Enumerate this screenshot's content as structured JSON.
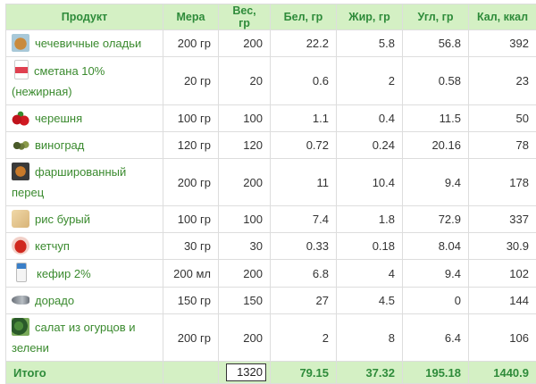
{
  "table": {
    "headers": [
      "Продукт",
      "Мера",
      "Вес, гр",
      "Бел, гр",
      "Жир, гр",
      "Угл, гр",
      "Кал, ккал"
    ],
    "rows": [
      {
        "name": "чечевичные оладьи",
        "icon": "pancakes-icon",
        "measure": "200 гр",
        "weight": "200",
        "protein": "22.2",
        "fat": "5.8",
        "carbs": "56.8",
        "kcal": "392"
      },
      {
        "name": "сметана 10% (нежирная)",
        "icon": "sour-cream-icon",
        "measure": "20 гр",
        "weight": "20",
        "protein": "0.6",
        "fat": "2",
        "carbs": "0.58",
        "kcal": "23"
      },
      {
        "name": "черешня",
        "icon": "cherry-icon",
        "measure": "100 гр",
        "weight": "100",
        "protein": "1.1",
        "fat": "0.4",
        "carbs": "11.5",
        "kcal": "50"
      },
      {
        "name": "виноград",
        "icon": "grapes-icon",
        "measure": "120 гр",
        "weight": "120",
        "protein": "0.72",
        "fat": "0.24",
        "carbs": "20.16",
        "kcal": "78"
      },
      {
        "name": "фаршированный перец",
        "icon": "stuffed-pepper-icon",
        "measure": "200 гр",
        "weight": "200",
        "protein": "11",
        "fat": "10.4",
        "carbs": "9.4",
        "kcal": "178"
      },
      {
        "name": "рис бурый",
        "icon": "rice-icon",
        "measure": "100 гр",
        "weight": "100",
        "protein": "7.4",
        "fat": "1.8",
        "carbs": "72.9",
        "kcal": "337"
      },
      {
        "name": "кетчуп",
        "icon": "ketchup-icon",
        "measure": "30 гр",
        "weight": "30",
        "protein": "0.33",
        "fat": "0.18",
        "carbs": "8.04",
        "kcal": "30.9"
      },
      {
        "name": "кефир 2%",
        "icon": "kefir-icon",
        "measure": "200 мл",
        "weight": "200",
        "protein": "6.8",
        "fat": "4",
        "carbs": "9.4",
        "kcal": "102"
      },
      {
        "name": "дорадо",
        "icon": "fish-icon",
        "measure": "150 гр",
        "weight": "150",
        "protein": "27",
        "fat": "4.5",
        "carbs": "0",
        "kcal": "144"
      },
      {
        "name": "салат из огурцов и зелени",
        "icon": "salad-icon",
        "measure": "200 гр",
        "weight": "200",
        "protein": "2",
        "fat": "8",
        "carbs": "6.4",
        "kcal": "106"
      }
    ],
    "total": {
      "label": "Итого",
      "weight": "1320",
      "protein": "79.15",
      "fat": "37.32",
      "carbs": "195.18",
      "kcal": "1440.9"
    }
  },
  "colors": {
    "header_bg": "#d4f0c4",
    "header_text": "#2e8b3a",
    "product_link": "#3a8a2e",
    "border": "#dddddd"
  }
}
